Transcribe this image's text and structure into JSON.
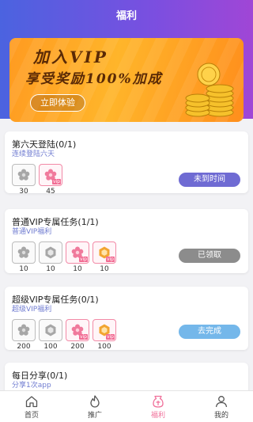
{
  "header": {
    "title": "福利"
  },
  "banner": {
    "line1": "加入VIP",
    "line2": "享受奖励100%加成",
    "button": "立即体验"
  },
  "colors": {
    "header_gradient_start": "#4b63e0",
    "header_gradient_end": "#a046d6",
    "status_pending": "#6f6bd3",
    "status_done": "#8c8c8c",
    "status_go": "#74b7ea",
    "vip_accent": "#f26b93",
    "tab_active": "#f0709a"
  },
  "tasks": [
    {
      "title": "第六天登陆(0/1)",
      "subtitle": "连续登陆六天",
      "rewards": [
        {
          "icon": "flower-icon",
          "vip": false,
          "vip_label": "",
          "value": "30"
        },
        {
          "icon": "flower-icon",
          "vip": true,
          "vip_label": "vip",
          "value": "45"
        }
      ],
      "status": "未到时间"
    },
    {
      "title": "普通VIP专属任务(1/1)",
      "subtitle": "普通VIP福利",
      "rewards": [
        {
          "icon": "flower-icon",
          "vip": false,
          "vip_label": "",
          "value": "10"
        },
        {
          "icon": "hexagon-icon",
          "vip": false,
          "vip_label": "",
          "value": "10"
        },
        {
          "icon": "flower-icon",
          "vip": true,
          "vip_label": "vip",
          "value": "10"
        },
        {
          "icon": "hexagon-icon",
          "vip": true,
          "vip_label": "vip",
          "value": "10"
        }
      ],
      "status": "已领取"
    },
    {
      "title": "超级VIP专属任务(0/1)",
      "subtitle": "超级VIP福利",
      "rewards": [
        {
          "icon": "flower-icon",
          "vip": false,
          "vip_label": "",
          "value": "200"
        },
        {
          "icon": "hexagon-icon",
          "vip": false,
          "vip_label": "",
          "value": "100"
        },
        {
          "icon": "flower-icon",
          "vip": true,
          "vip_label": "vip",
          "value": "200"
        },
        {
          "icon": "hexagon-icon",
          "vip": true,
          "vip_label": "vip",
          "value": "100"
        }
      ],
      "status": "去完成"
    },
    {
      "title": "每日分享(0/1)",
      "subtitle": "分享1次app"
    }
  ],
  "tabbar": {
    "items": [
      {
        "label": "首页",
        "icon": "home-icon"
      },
      {
        "label": "推广",
        "icon": "flame-icon"
      },
      {
        "label": "福利",
        "icon": "gift-icon"
      },
      {
        "label": "我的",
        "icon": "user-icon"
      }
    ]
  }
}
